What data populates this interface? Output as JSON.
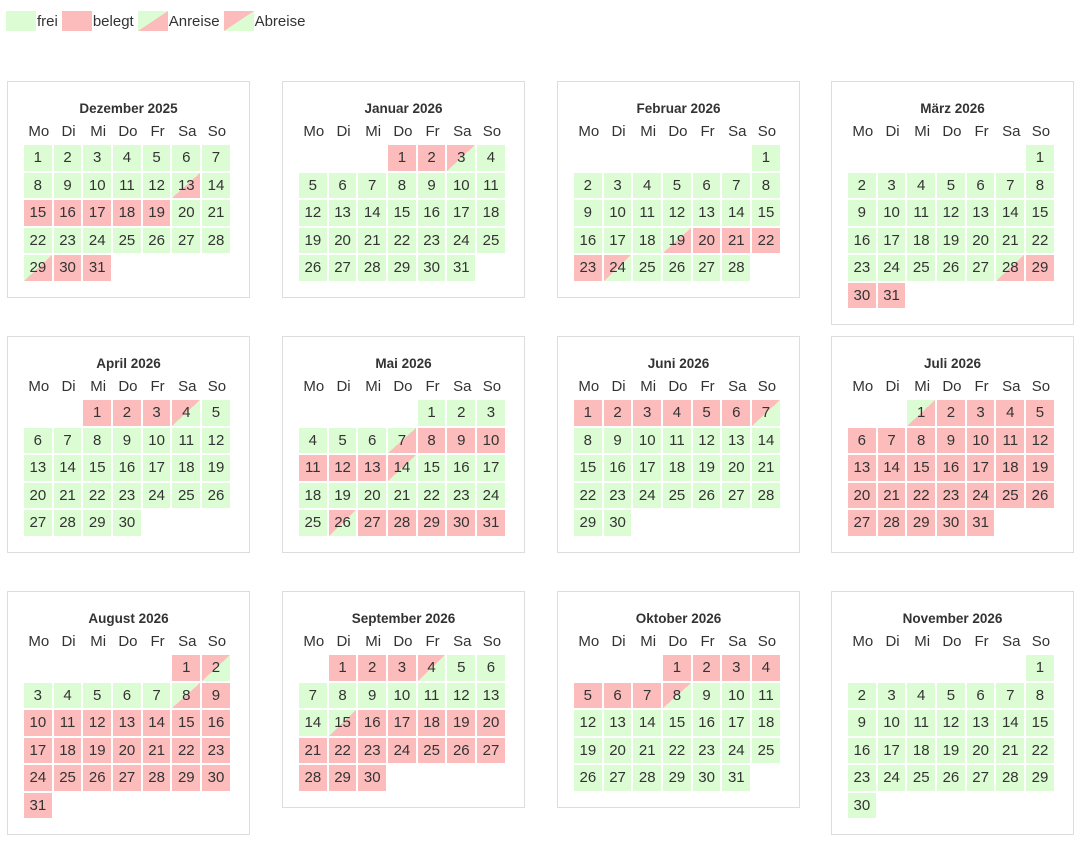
{
  "legend": [
    {
      "status": "frei",
      "label": "frei"
    },
    {
      "status": "belegt",
      "label": "belegt"
    },
    {
      "status": "anreise",
      "label": "Anreise"
    },
    {
      "status": "abreise",
      "label": "Abreise"
    }
  ],
  "colors": {
    "frei": "#dcfcd3",
    "belegt": "#fcbcbc"
  },
  "weekdays": [
    "Mo",
    "Di",
    "Mi",
    "Do",
    "Fr",
    "Sa",
    "So"
  ],
  "months": [
    {
      "title": "Dezember 2025",
      "offset": 0,
      "days": 31,
      "belegt": [
        15,
        16,
        17,
        18,
        19,
        30,
        31
      ],
      "anreise": [
        13,
        29
      ],
      "abreise": []
    },
    {
      "title": "Januar 2026",
      "offset": 3,
      "days": 31,
      "belegt": [
        1,
        2
      ],
      "anreise": [],
      "abreise": [
        3
      ]
    },
    {
      "title": "Februar 2026",
      "offset": 6,
      "days": 28,
      "belegt": [
        20,
        21,
        22,
        23
      ],
      "anreise": [
        19
      ],
      "abreise": [
        24
      ]
    },
    {
      "title": "März 2026",
      "offset": 6,
      "days": 31,
      "belegt": [
        29,
        30,
        31
      ],
      "anreise": [
        28
      ],
      "abreise": []
    },
    {
      "title": "April 2026",
      "offset": 2,
      "days": 30,
      "belegt": [
        1,
        2,
        3
      ],
      "anreise": [],
      "abreise": [
        4
      ]
    },
    {
      "title": "Mai 2026",
      "offset": 4,
      "days": 31,
      "belegt": [
        8,
        9,
        10,
        11,
        12,
        13,
        27,
        28,
        29,
        30,
        31
      ],
      "anreise": [
        7
      ],
      "abreise": [
        14,
        26
      ]
    },
    {
      "title": "Juni 2026",
      "offset": 0,
      "days": 30,
      "belegt": [
        1,
        2,
        3,
        4,
        5,
        6
      ],
      "anreise": [],
      "abreise": [
        7
      ]
    },
    {
      "title": "Juli 2026",
      "offset": 2,
      "days": 31,
      "belegt": [
        2,
        3,
        4,
        5,
        6,
        7,
        8,
        9,
        10,
        11,
        12,
        13,
        14,
        15,
        16,
        17,
        18,
        19,
        20,
        21,
        22,
        23,
        24,
        25,
        26,
        27,
        28,
        29,
        30,
        31
      ],
      "anreise": [
        1
      ],
      "abreise": []
    },
    {
      "title": "August 2026",
      "offset": 5,
      "days": 31,
      "belegt": [
        1,
        9,
        10,
        11,
        12,
        13,
        14,
        15,
        16,
        17,
        18,
        19,
        20,
        21,
        22,
        23,
        24,
        25,
        26,
        27,
        28,
        29,
        30,
        31
      ],
      "anreise": [
        8
      ],
      "abreise": [
        2
      ]
    },
    {
      "title": "September 2026",
      "offset": 1,
      "days": 30,
      "belegt": [
        1,
        2,
        3,
        16,
        17,
        18,
        19,
        20,
        21,
        22,
        23,
        24,
        25,
        26,
        27,
        28,
        29,
        30
      ],
      "anreise": [
        15
      ],
      "abreise": [
        4
      ]
    },
    {
      "title": "Oktober 2026",
      "offset": 3,
      "days": 31,
      "belegt": [
        1,
        2,
        3,
        4,
        5,
        6,
        7
      ],
      "anreise": [],
      "abreise": [
        8
      ]
    },
    {
      "title": "November 2026",
      "offset": 6,
      "days": 30,
      "belegt": [],
      "anreise": [],
      "abreise": []
    }
  ]
}
